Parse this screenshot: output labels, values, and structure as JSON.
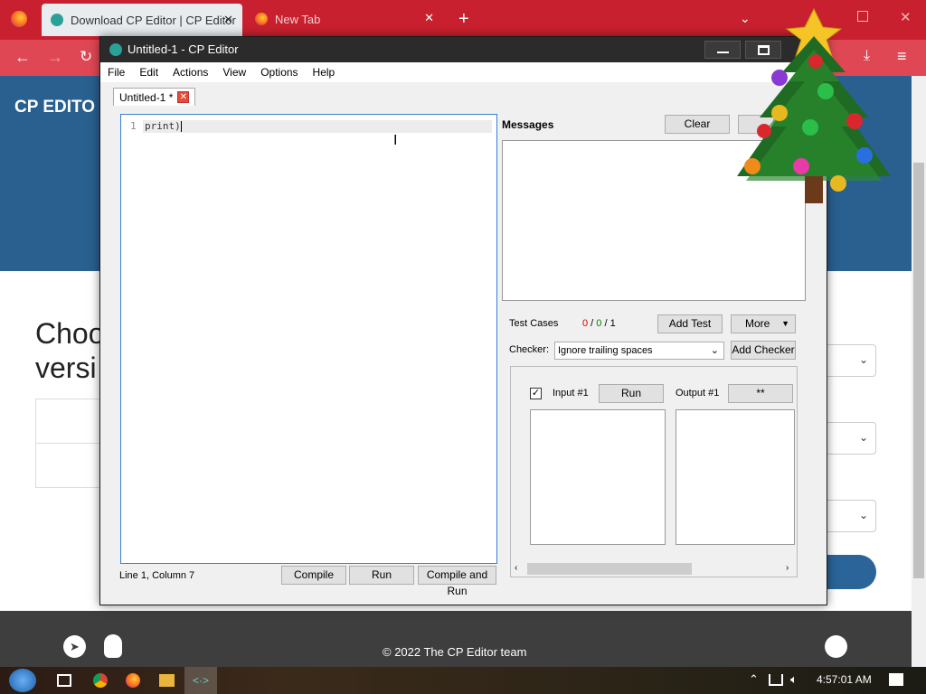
{
  "browser": {
    "tabs": [
      {
        "label": "Download CP Editor | CP Editor"
      },
      {
        "label": "New Tab"
      }
    ],
    "new_tab_icon": "+",
    "site": {
      "logo": "CP EDITO",
      "heading": "Choo versi",
      "footer_copyright": "© 2022 The CP Editor team"
    }
  },
  "window": {
    "title": "Untitled-1 - CP Editor",
    "menus": [
      "File",
      "Edit",
      "Actions",
      "View",
      "Options",
      "Help"
    ],
    "doc_tab": "Untitled-1 *",
    "editor": {
      "line_number": "1",
      "code": "print)"
    },
    "status": "Line 1, Column 7",
    "buttons": {
      "compile": "Compile",
      "run": "Run",
      "compile_and_run": "Compile and Run",
      "clear": "Clear",
      "add_test": "Add Test",
      "more": "More",
      "add_checker": "Add Checker",
      "test_run": "Run",
      "output_diff": "**"
    },
    "messages_label": "Messages",
    "test_cases_label": "Test Cases",
    "test_counts": {
      "failed": "0",
      "passed": "0",
      "total": "1"
    },
    "checker_label": "Checker:",
    "checker_value": "Ignore trailing spaces",
    "input_label": "Input #1",
    "output_label": "Output #1"
  },
  "taskbar": {
    "clock": "4:57:01 AM"
  },
  "colors": {
    "browser_red": "#c8202f",
    "site_blue": "#29608f",
    "fail": "#d00000",
    "pass": "#008000"
  }
}
